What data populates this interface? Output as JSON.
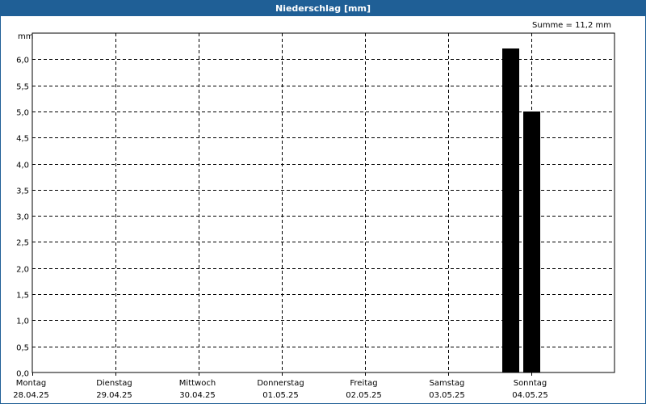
{
  "window": {
    "title": "Niederschlag [mm]"
  },
  "summary": {
    "text": "Summe = 11,2 mm"
  },
  "chart_data": {
    "type": "bar",
    "title": "Niederschlag [mm]",
    "ylabel": "mm",
    "xlabel": "",
    "ylim": [
      0,
      6.5
    ],
    "yticks": [
      "0,0",
      "0,5",
      "1,0",
      "1,5",
      "2,0",
      "2,5",
      "3,0",
      "3,5",
      "4,0",
      "4,5",
      "5,0",
      "5,5",
      "6,0"
    ],
    "days": [
      {
        "weekday": "Montag",
        "date": "28.04.25"
      },
      {
        "weekday": "Dienstag",
        "date": "29.04.25"
      },
      {
        "weekday": "Mittwoch",
        "date": "30.04.25"
      },
      {
        "weekday": "Donnerstag",
        "date": "01.05.25"
      },
      {
        "weekday": "Freitag",
        "date": "02.05.25"
      },
      {
        "weekday": "Samstag",
        "date": "03.05.25"
      },
      {
        "weekday": "Sonntag",
        "date": "04.05.25"
      }
    ],
    "bars": [
      {
        "date": "03.05.25 18:00",
        "value": 6.2
      },
      {
        "date": "04.05.25 00:00",
        "value": 5.0
      }
    ],
    "grid": true,
    "bar_color": "#000000"
  }
}
